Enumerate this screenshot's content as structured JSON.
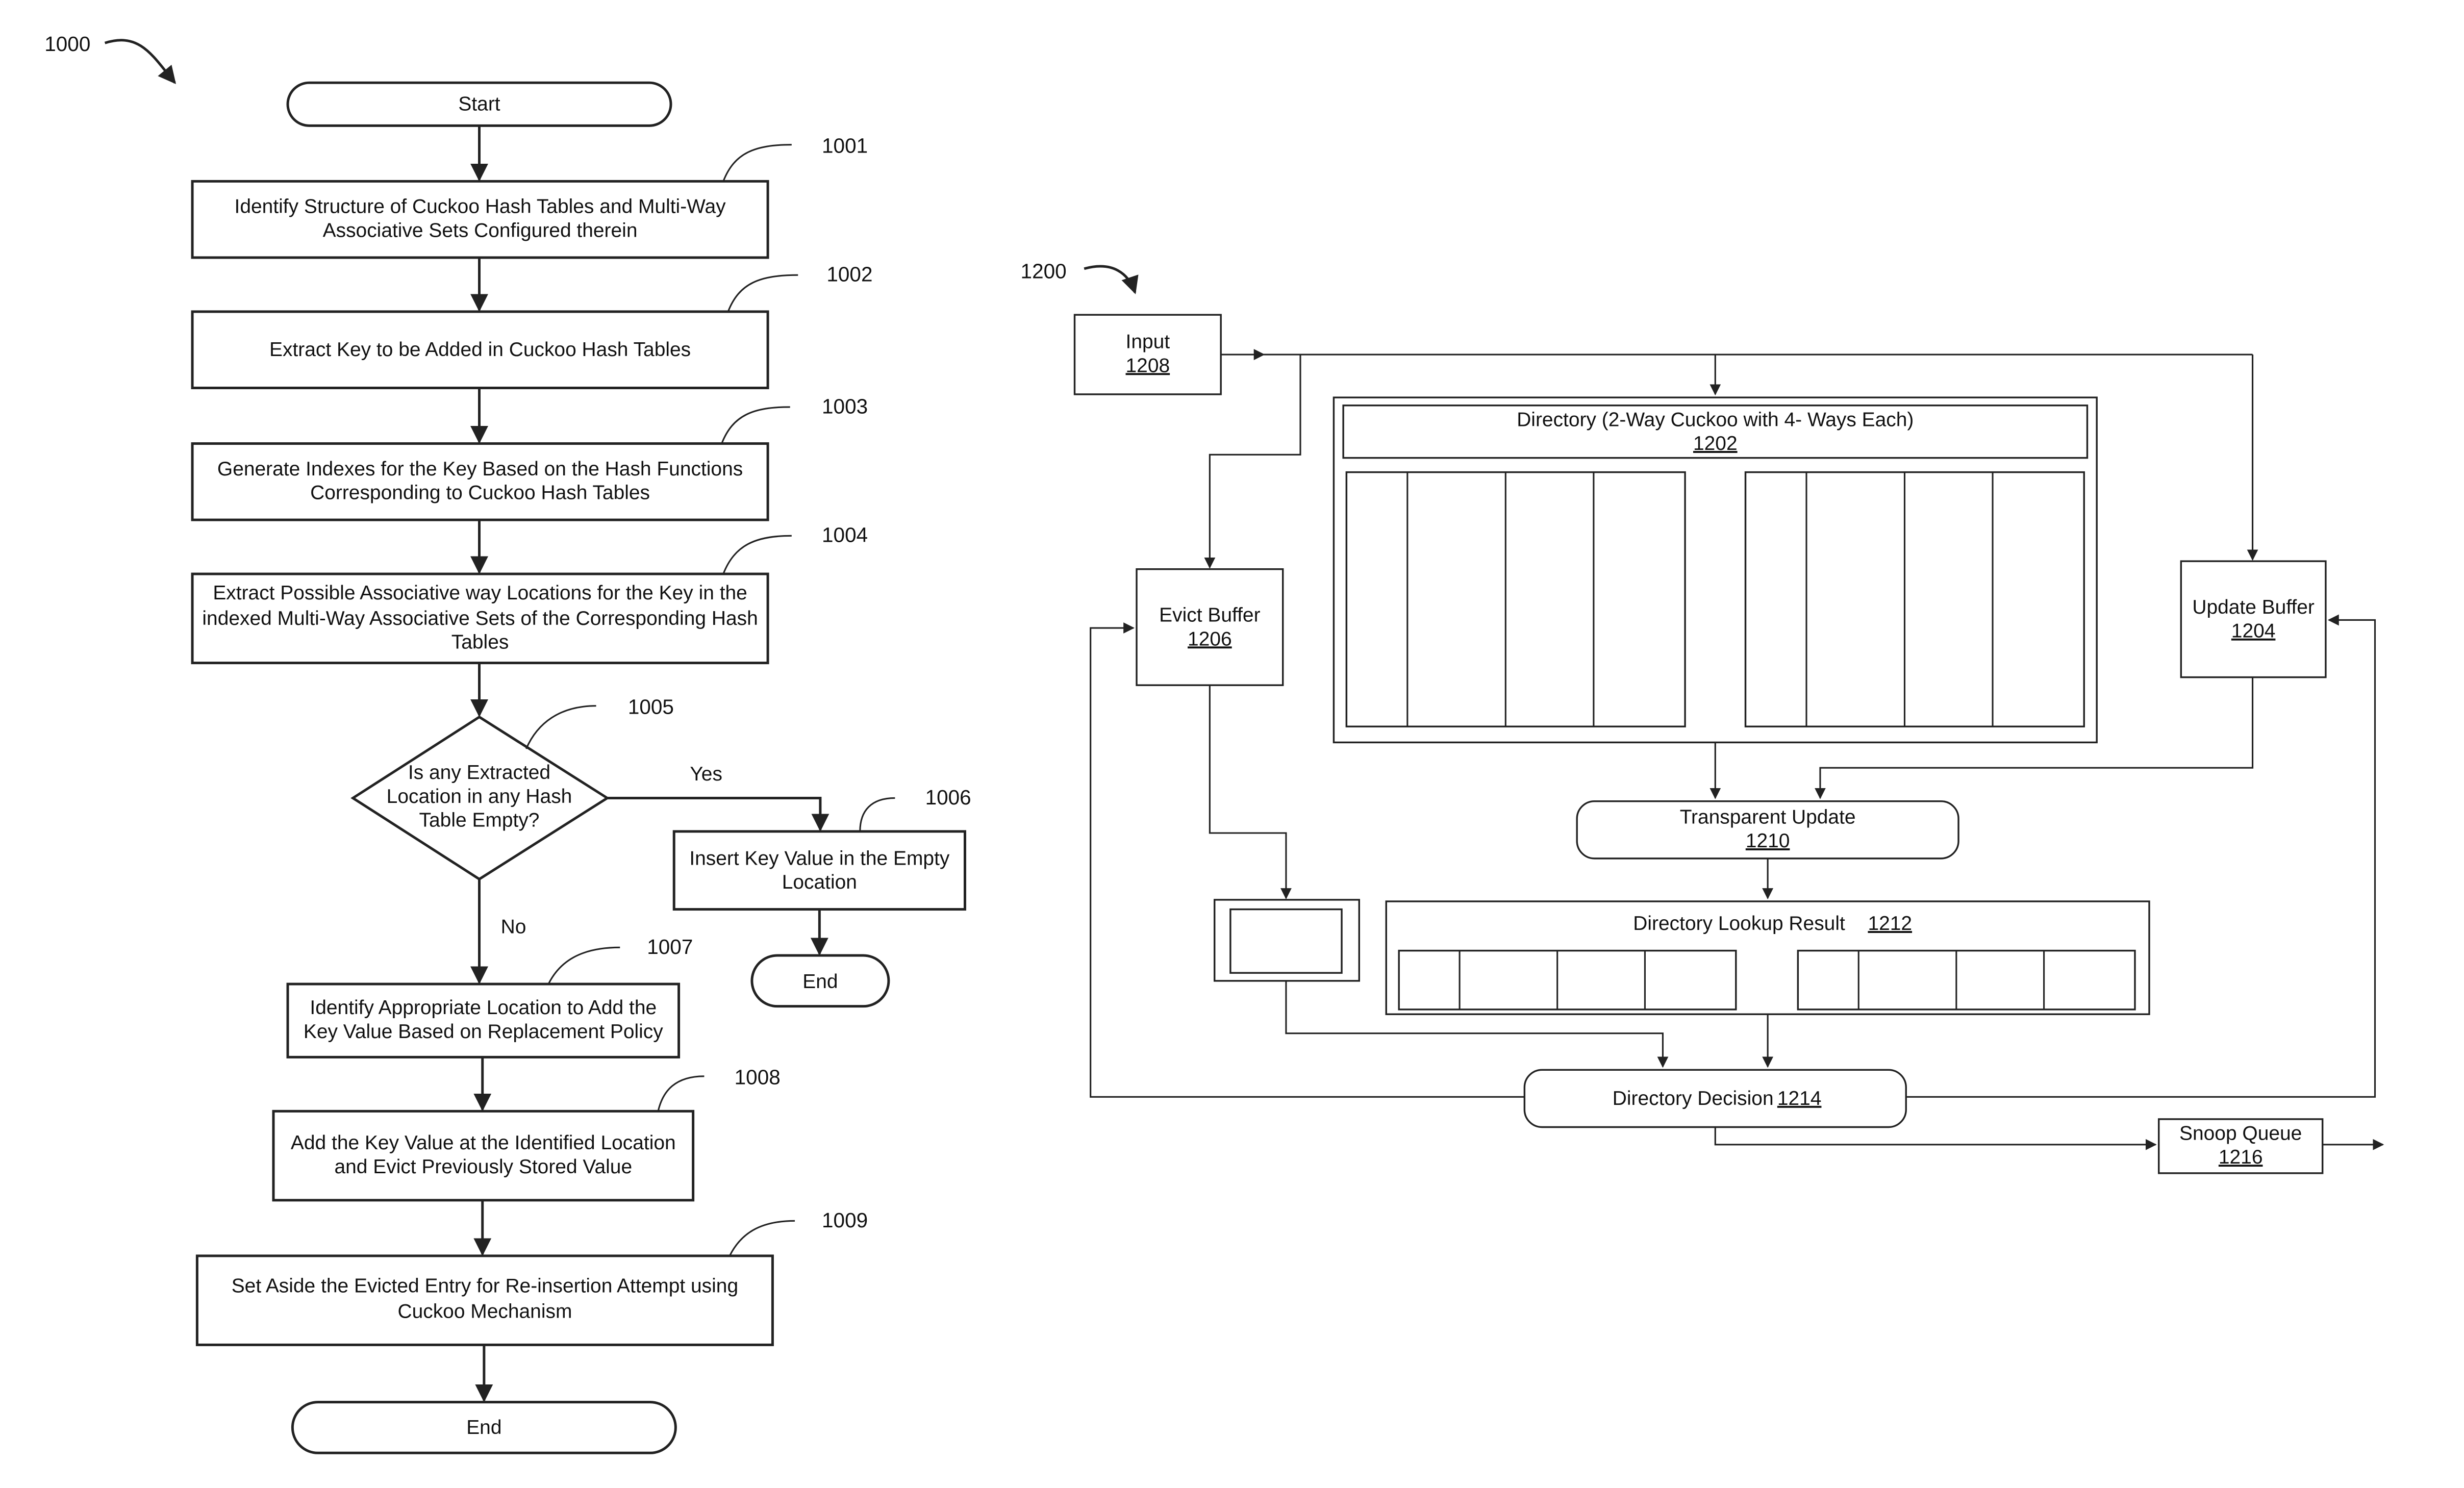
{
  "figure_1000": {
    "ref_label": "1000",
    "steps": [
      {
        "id": "start",
        "type": "terminal",
        "lines": [
          "Start"
        ]
      },
      {
        "id": "1001",
        "type": "process",
        "ref": "1001",
        "lines": [
          "Identify Structure of Cuckoo Hash Tables and Multi-Way",
          "Associative Sets Configured therein"
        ]
      },
      {
        "id": "1002",
        "type": "process",
        "ref": "1002",
        "lines": [
          "Extract Key to be Added in Cuckoo Hash Tables"
        ]
      },
      {
        "id": "1003",
        "type": "process",
        "ref": "1003",
        "lines": [
          "Generate Indexes for the Key Based on the Hash Functions",
          "Corresponding to Cuckoo Hash Tables"
        ]
      },
      {
        "id": "1004",
        "type": "process",
        "ref": "1004",
        "lines": [
          "Extract Possible Associative way Locations for the Key in the",
          "indexed Multi-Way Associative Sets of the Corresponding Hash",
          "Tables"
        ]
      },
      {
        "id": "1005",
        "type": "decision",
        "ref": "1005",
        "lines": [
          "Is any Extracted",
          "Location in any Hash",
          "Table Empty?"
        ]
      },
      {
        "id": "1006",
        "type": "process",
        "ref": "1006",
        "lines": [
          "Insert Key Value in the Empty",
          "Location"
        ]
      },
      {
        "id": "end_yes",
        "type": "terminal",
        "lines": [
          "End"
        ]
      },
      {
        "id": "1007",
        "type": "process",
        "ref": "1007",
        "lines": [
          "Identify Appropriate Location to Add the",
          "Key Value Based on Replacement Policy"
        ]
      },
      {
        "id": "1008",
        "type": "process",
        "ref": "1008",
        "lines": [
          "Add the Key Value at the Identified Location",
          "and Evict Previously Stored Value"
        ]
      },
      {
        "id": "1009",
        "type": "process",
        "ref": "1009",
        "lines": [
          "Set Aside the Evicted Entry for Re-insertion Attempt using",
          "Cuckoo Mechanism"
        ]
      },
      {
        "id": "end_main",
        "type": "terminal",
        "lines": [
          "End"
        ]
      }
    ],
    "branch_labels": {
      "yes": "Yes",
      "no": "No"
    }
  },
  "figure_1200": {
    "ref_label": "1200",
    "input": {
      "label": "Input",
      "ref": "1208"
    },
    "directory": {
      "label": "Directory (2-Way Cuckoo with 4- Ways Each)",
      "ref": "1202",
      "tables": 2,
      "ways_per_table": 4
    },
    "evict_buffer": {
      "label": "Evict Buffer",
      "ref": "1206"
    },
    "update_buffer": {
      "label": "Update Buffer",
      "ref": "1204"
    },
    "transparent_update": {
      "label": "Transparent Update",
      "ref": "1210"
    },
    "lookup_result": {
      "label": "Directory Lookup Result",
      "ref": "1212",
      "tables": 2,
      "ways_per_table": 4
    },
    "directory_decision": {
      "label": "Directory Decision",
      "ref": "1214"
    },
    "snoop_queue": {
      "label": "Snoop Queue",
      "ref": "1216"
    }
  }
}
